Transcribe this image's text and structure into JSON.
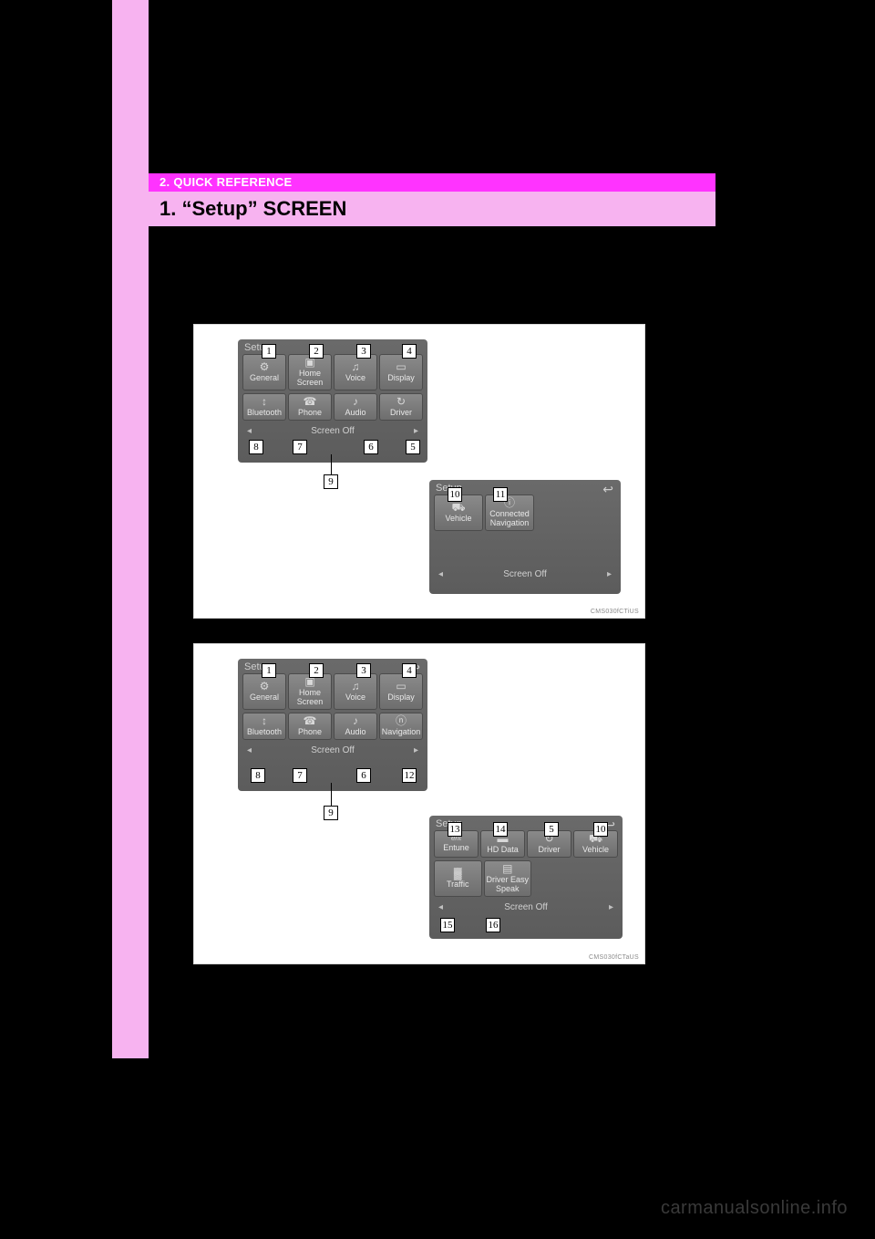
{
  "chapter_label": "2. QUICK REFERENCE",
  "section_title": "1. “Setup” SCREEN",
  "watermark": "carmanualsonline.info",
  "screenshot_a": {
    "image_code": "CMS030fCTiUS",
    "panel1": {
      "header": "Setup",
      "row1": [
        "General",
        "Home Screen",
        "Voice",
        "Display"
      ],
      "row1_icons": [
        "⚙",
        "▣",
        "♫",
        "▭"
      ],
      "row2": [
        "Bluetooth",
        "Phone",
        "Audio",
        "Driver"
      ],
      "row2_icons": [
        "↕",
        "☎",
        "♪",
        "↻"
      ],
      "bottom": "Screen Off"
    },
    "panel2": {
      "header": "Setup",
      "row1": [
        "Vehicle",
        "Connected Navigation"
      ],
      "row1_icons": [
        "⛟",
        "ⓘ"
      ],
      "bottom": "Screen Off"
    },
    "callouts_p1": [
      "1",
      "2",
      "3",
      "4",
      "5",
      "6",
      "7",
      "8",
      "9"
    ],
    "callouts_p2": [
      "10",
      "11"
    ]
  },
  "screenshot_b": {
    "image_code": "CMS030fCTaUS",
    "panel1": {
      "header": "Setup",
      "row1": [
        "General",
        "Home Screen",
        "Voice",
        "Display"
      ],
      "row1_icons": [
        "⚙",
        "▣",
        "♫",
        "▭"
      ],
      "row2": [
        "Bluetooth",
        "Phone",
        "Audio",
        "Navigation"
      ],
      "row2_icons": [
        "↕",
        "☎",
        "♪",
        "ⓝ"
      ],
      "bottom": "Screen Off"
    },
    "panel2": {
      "header": "Setup",
      "row1": [
        "Entune",
        "HD Data",
        "Driver",
        "Vehicle"
      ],
      "row1_icons": [
        "ent",
        "▬",
        "↻",
        "⛟"
      ],
      "row2": [
        "Traffic",
        "Driver Easy Speak"
      ],
      "row2_icons": [
        "▓",
        "▤"
      ],
      "bottom": "Screen Off"
    },
    "callouts_p1": [
      "1",
      "2",
      "3",
      "4",
      "6",
      "7",
      "8",
      "9",
      "12"
    ],
    "callouts_p2": [
      "13",
      "14",
      "5",
      "10",
      "15",
      "16"
    ]
  },
  "arrows": {
    "left": "◂",
    "right": "▸",
    "back": "↩"
  }
}
